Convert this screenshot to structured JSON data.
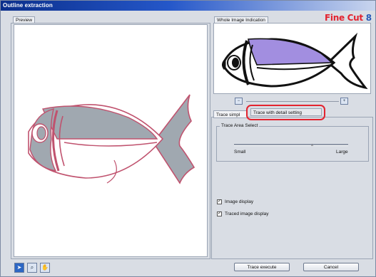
{
  "window": {
    "title": "Outline extraction"
  },
  "logo": {
    "text": "Fine Cut",
    "suffix": "8"
  },
  "preview": {
    "label": "Preview"
  },
  "whole_image": {
    "label": "Whole Image Indication"
  },
  "tabs": [
    {
      "label": "Trace simpl"
    },
    {
      "label": "Trace with detail setting"
    }
  ],
  "trace_area": {
    "label": "Trace Area Select",
    "min_label": "Small",
    "max_label": "Large"
  },
  "options": {
    "image_display": {
      "label": "Image display",
      "checked": true
    },
    "traced_image_display": {
      "label": "Traced image display",
      "checked": true
    }
  },
  "buttons": {
    "execute": "Trace execute",
    "cancel": "Cancel"
  },
  "tools": [
    {
      "icon": "pointer-icon"
    },
    {
      "icon": "magnifier-icon"
    },
    {
      "icon": "hand-icon"
    }
  ],
  "colors": {
    "title_bar": "#0b2f8c",
    "highlight": "#e3232f",
    "fish_fill_preview": "#a0a8b0",
    "fish_outline_preview": "#c0526e",
    "fish_fill_whole": "#a28ee0"
  }
}
